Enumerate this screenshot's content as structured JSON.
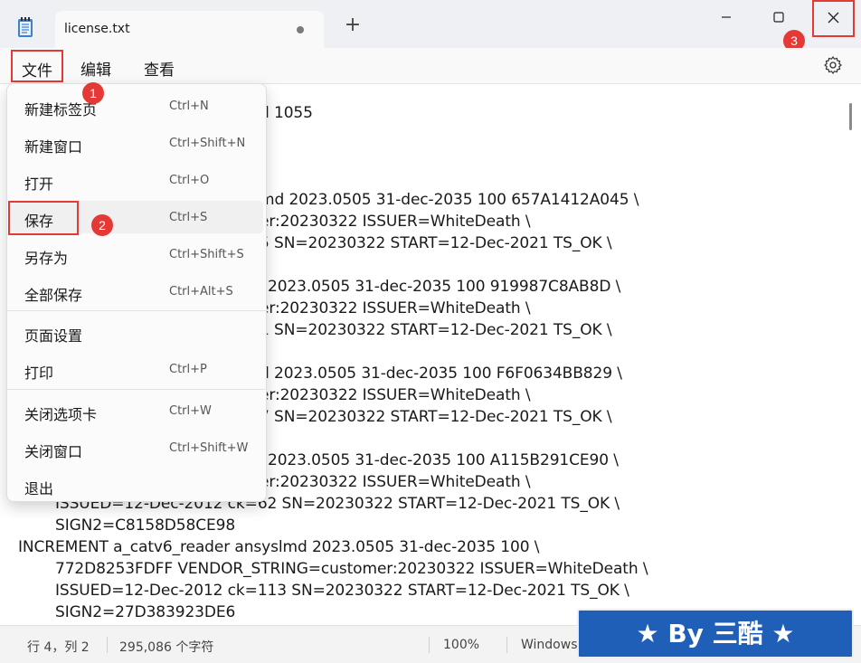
{
  "titlebar": {
    "tab_title": "license.txt",
    "new_tab_symbol": "+",
    "icons": [
      "notepad-icon",
      "tab-modified-dot-icon",
      "minimize-icon",
      "maximize-icon",
      "close-icon"
    ]
  },
  "menubar": {
    "file": "文件",
    "edit": "编辑",
    "view": "查看",
    "settings_icon": "gear-icon"
  },
  "dropdown": {
    "items": [
      {
        "label": "新建标签页",
        "shortcut": "Ctrl+N"
      },
      {
        "label": "新建窗口",
        "shortcut": "Ctrl+Shift+N"
      },
      {
        "label": "打开",
        "shortcut": "Ctrl+O"
      },
      {
        "label": "保存",
        "shortcut": "Ctrl+S"
      },
      {
        "label": "另存为",
        "shortcut": "Ctrl+Shift+S"
      },
      {
        "label": "全部保存",
        "shortcut": "Ctrl+Alt+S"
      },
      {
        "label": "页面设置",
        "shortcut": ""
      },
      {
        "label": "打印",
        "shortcut": "Ctrl+P"
      },
      {
        "label": "关闭选项卡",
        "shortcut": "Ctrl+W"
      },
      {
        "label": "关闭窗口",
        "shortcut": "Ctrl+Shift+W"
      },
      {
        "label": "退出",
        "shortcut": ""
      }
    ]
  },
  "editor": {
    "lines": [
      "d 1055",
      "md 2023.0505 31-dec-2035 100 657A1412A045 \\",
      "er:20230322 ISSUER=WhiteDeath \\",
      "5 SN=20230322 START=12-Dec-2021 TS_OK \\",
      "2023.0505 31-dec-2035 100 919987C8AB8D \\",
      "er:20230322 ISSUER=WhiteDeath \\",
      "1 SN=20230322 START=12-Dec-2021 TS_OK \\",
      "d 2023.0505 31-dec-2035 100 F6F0634BB829 \\",
      "er:20230322 ISSUER=WhiteDeath \\",
      "7 SN=20230322 START=12-Dec-2021 TS_OK \\",
      "2023.0505 31-dec-2035 100 A115B291CE90 \\",
      "er:20230322 ISSUER=WhiteDeath \\",
      "ISSUED=12-Dec-2012 ck=62 SN=20230322 START=12-Dec-2021 TS_OK \\",
      "SIGN2=C8158D58CE98",
      "INCREMENT a_catv6_reader ansyslmd 2023.0505 31-dec-2035 100 \\",
      "772D8253FDFF VENDOR_STRING=customer:20230322 ISSUER=WhiteDeath \\",
      "ISSUED=12-Dec-2012 ck=113 SN=20230322 START=12-Dec-2021 TS_OK \\",
      "SIGN2=27D383923DE6"
    ]
  },
  "statusbar": {
    "position": "行 4，列 2",
    "char_count": "295,086 个字符",
    "zoom": "100%",
    "line_ending": "Windows"
  },
  "annotations": {
    "badge1": "1",
    "badge2": "2",
    "badge3": "3",
    "color": "#e53935"
  },
  "watermark": "★ By 三酷 ★"
}
